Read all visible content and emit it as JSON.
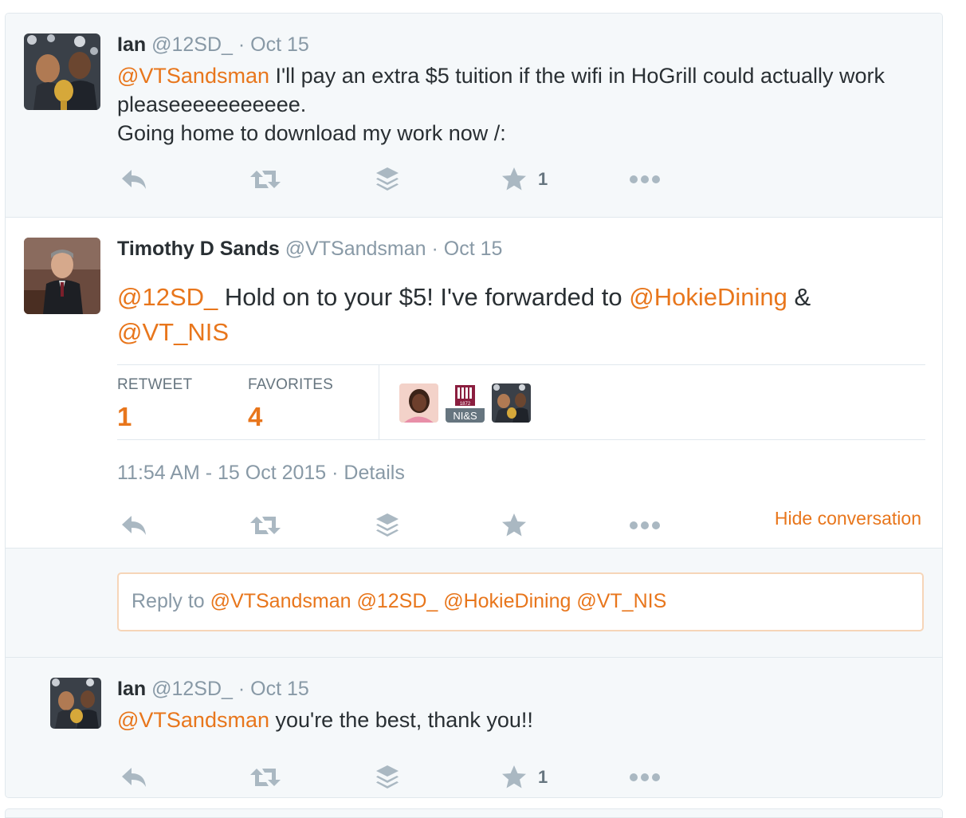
{
  "tweets": [
    {
      "fullname": "Ian",
      "username": "@12SD_",
      "date": "· Oct 15",
      "mention": "@VTSandsman",
      "text_line1": " I'll pay an extra $5 tuition if the wifi in HoGrill could actually work",
      "text_line2": "pleaseeeeeeeeeee.",
      "text_line3": "Going home to download my work now /:",
      "favorite_count": "1"
    },
    {
      "fullname": "Timothy D Sands",
      "username": "@VTSandsman",
      "date": "· Oct 15",
      "mention1": "@12SD_",
      "text1": " Hold on to your $5! I've forwarded to ",
      "mention2": "@HokieDining",
      "text2": " &",
      "mention3": "@VT_NIS",
      "stats": {
        "retweet_label": "RETWEET",
        "retweet_count": "1",
        "favorites_label": "FAVORITES",
        "favorites_count": "4",
        "nis_badge_text": "NI&S",
        "nis_badge_year": "1872"
      },
      "timestamp": "11:54 AM - 15 Oct 2015",
      "details_link": "· Details",
      "hide_conversation": "Hide conversation"
    },
    {
      "fullname": "Ian",
      "username": "@12SD_",
      "date": "· Oct 15",
      "mention": "@VTSandsman",
      "text": " you're the best, thank you!!",
      "favorite_count": "1"
    }
  ],
  "reply_box": {
    "prefix": "Reply to ",
    "mentions": "@VTSandsman @12SD_ @HokieDining @VT_NIS"
  },
  "icons": [
    "reply-icon",
    "retweet-icon",
    "buffer-icon",
    "favorite-icon",
    "more-icon"
  ],
  "colors": {
    "accent": "#e8761c",
    "text": "#292f33",
    "muted": "#8899a6",
    "icon": "#aab8c2",
    "background": "#f5f8fa"
  }
}
